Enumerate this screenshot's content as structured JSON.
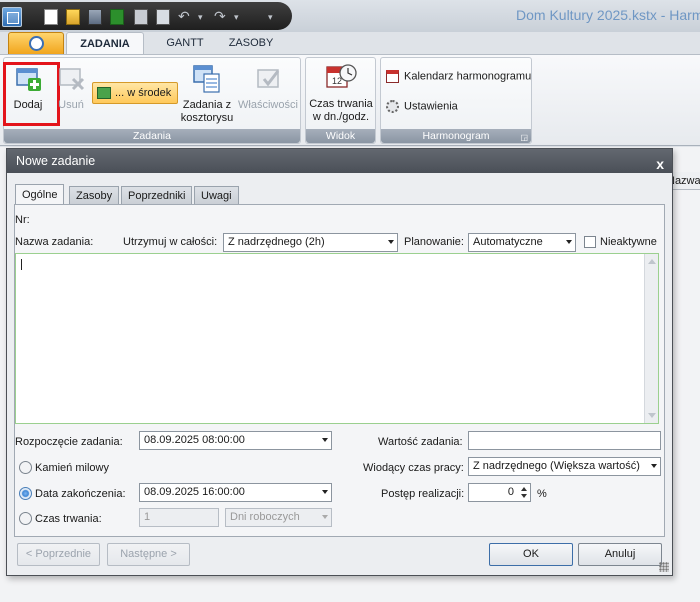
{
  "window": {
    "title": "Dom Kultury 2025.kstx - Harm"
  },
  "ribbon": {
    "tabs": [
      {
        "label": "ZADANIA",
        "active": true
      },
      {
        "label": "GANTT",
        "active": false
      },
      {
        "label": "ZASOBY",
        "active": false
      }
    ],
    "groups": {
      "zadania": {
        "label": "Zadania",
        "dodaj": "Dodaj",
        "usun": "Usuń",
        "wsrodek": "... w środek",
        "kosztorys": "Zadania z kosztorysu",
        "wlasciwosci": "Właściwości"
      },
      "widok": {
        "label": "Widok",
        "czas_trwania": "Czas trwania w dn./godz."
      },
      "harmonogram": {
        "label": "Harmonogram",
        "kalendarz": "Kalendarz harmonogramu",
        "ustawienia": "Ustawienia"
      }
    }
  },
  "background": {
    "column_header": "Nazwa zadanie"
  },
  "dialog": {
    "title": "Nowe zadanie",
    "tabs": [
      "Ogólne",
      "Zasoby",
      "Poprzedniki",
      "Uwagi"
    ],
    "nr_label": "Nr:",
    "nazwa_label": "Nazwa zadania:",
    "utrzymuj_label": "Utrzymuj w całości:",
    "utrzymuj_value": "Z nadrzędnego (2h)",
    "planowanie_label": "Planowanie:",
    "planowanie_value": "Automatyczne",
    "nieaktywne_label": "Nieaktywne",
    "rozpoczecie_label": "Rozpoczęcie zadania:",
    "rozpoczecie_value": "08.09.2025 08:00:00",
    "kamien_label": "Kamień milowy",
    "data_zak_label": "Data zakończenia:",
    "data_zak_value": "08.09.2025 16:00:00",
    "czas_label": "Czas trwania:",
    "czas_value": "1",
    "czas_unit": "Dni roboczych",
    "wartosc_label": "Wartość zadania:",
    "wartosc_value": "",
    "wiodacy_label": "Wiodący czas pracy:",
    "wiodacy_value": "Z nadrzędnego (Większa wartość)",
    "postep_label": "Postęp realizacji:",
    "postep_value": "0",
    "postep_unit": "%",
    "buttons": {
      "prev": "< Poprzednie",
      "next": "Następne >",
      "ok": "OK",
      "cancel": "Anuluj"
    }
  },
  "colors": {
    "accent": "#3d86d6",
    "highlight": "#e3141b",
    "title_text": "#6f97c4"
  }
}
